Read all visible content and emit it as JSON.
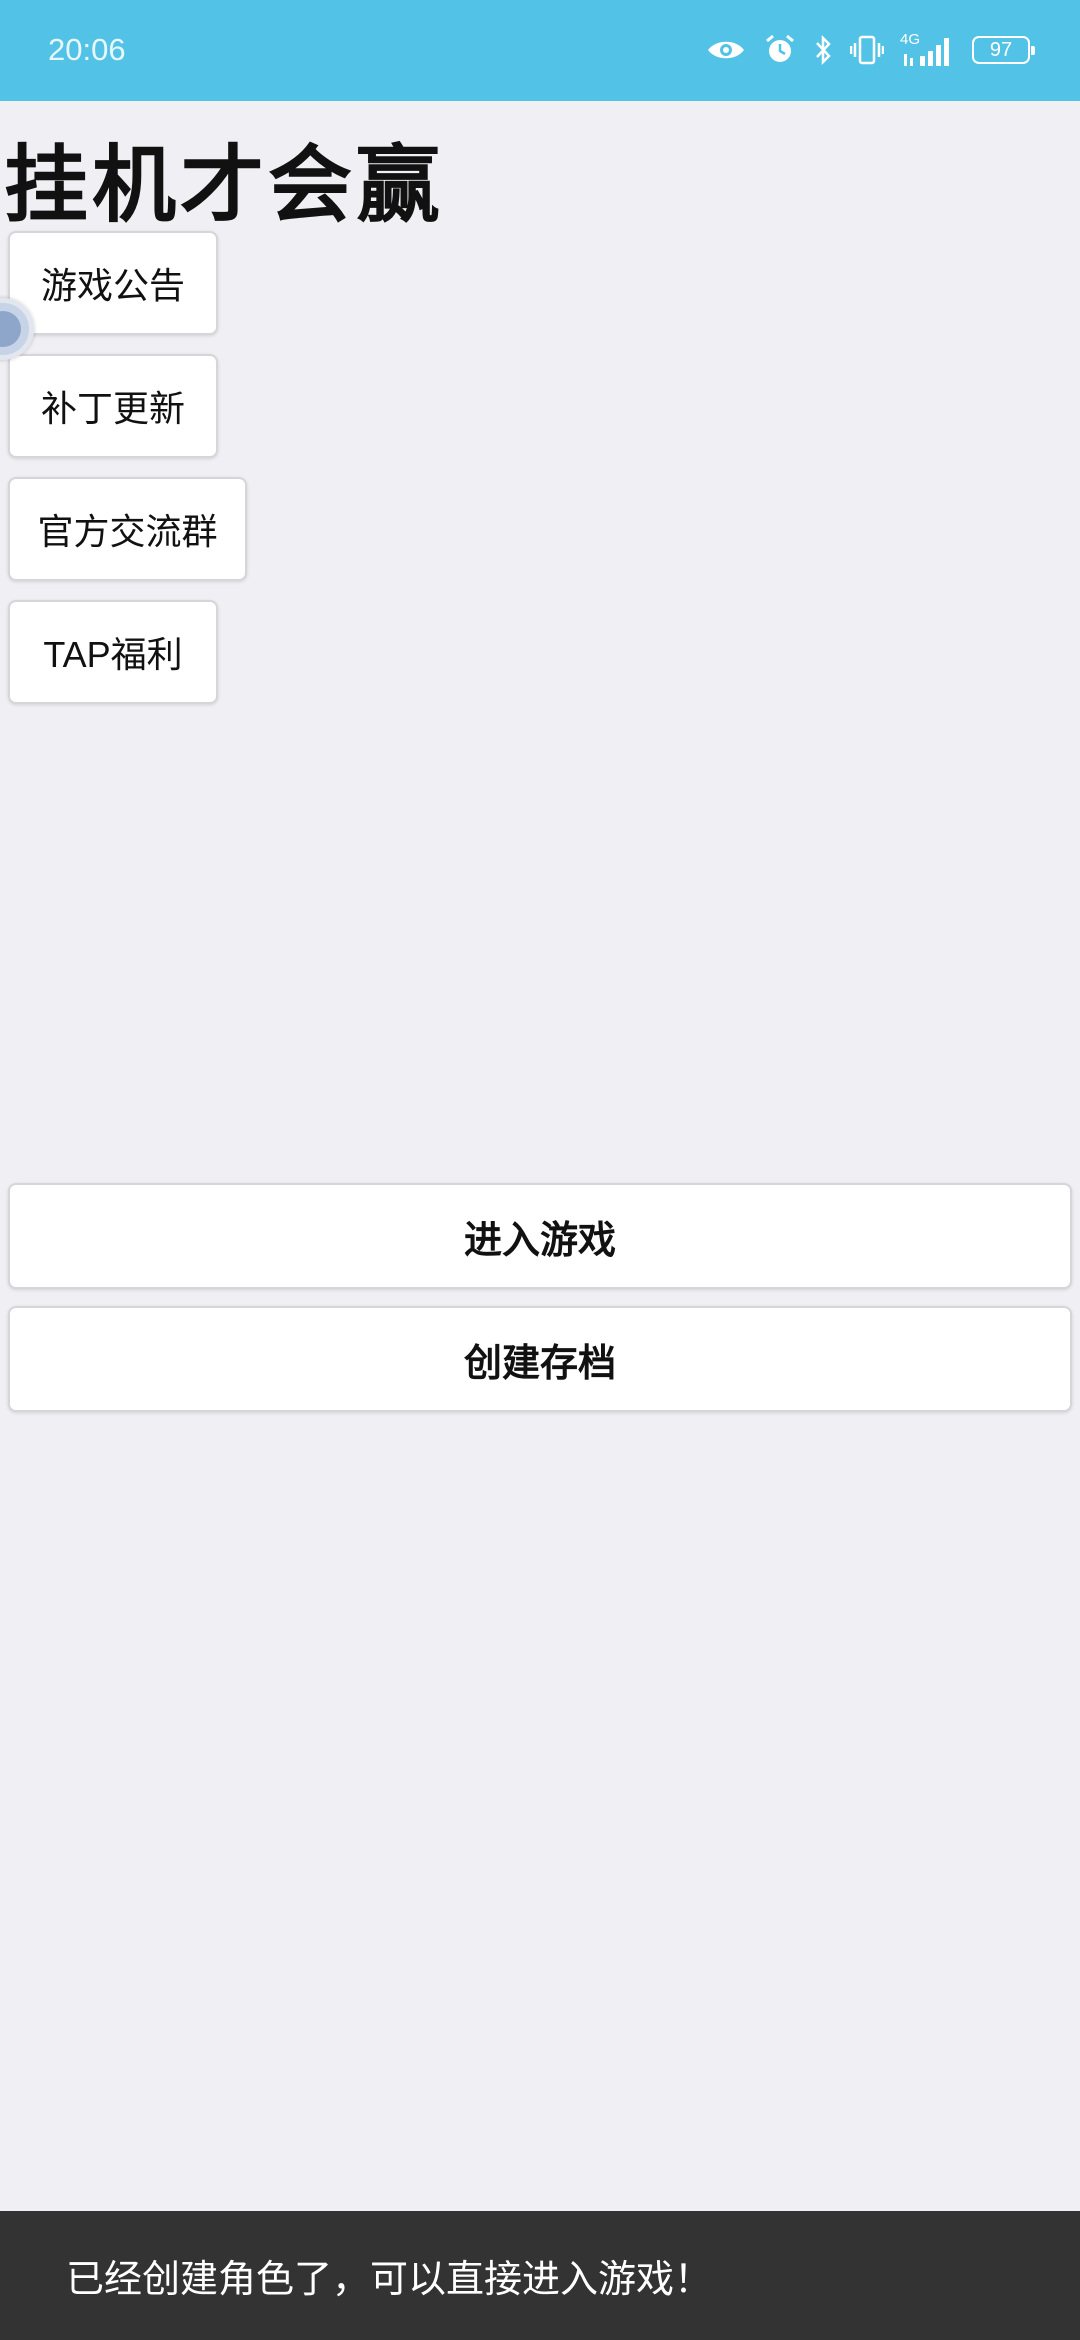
{
  "status_bar": {
    "time": "20:06",
    "network_label": "4G",
    "battery_level": "97",
    "icons": [
      "eye-icon",
      "alarm-icon",
      "bluetooth-icon",
      "vibrate-icon",
      "signal-icon",
      "battery-icon"
    ]
  },
  "title": "挂机才会赢",
  "side_buttons": {
    "notice": "游戏公告",
    "patch": "补丁更新",
    "group": "官方交流群",
    "tap": "TAP福利"
  },
  "main_buttons": {
    "enter_game": "进入游戏",
    "create_save": "创建存档"
  },
  "toast": {
    "message": "已经创建角色了，可以直接进入游戏！"
  },
  "colors": {
    "status_bar": "#52c3e6",
    "background": "#efeff4",
    "toast_background": "#333333"
  }
}
